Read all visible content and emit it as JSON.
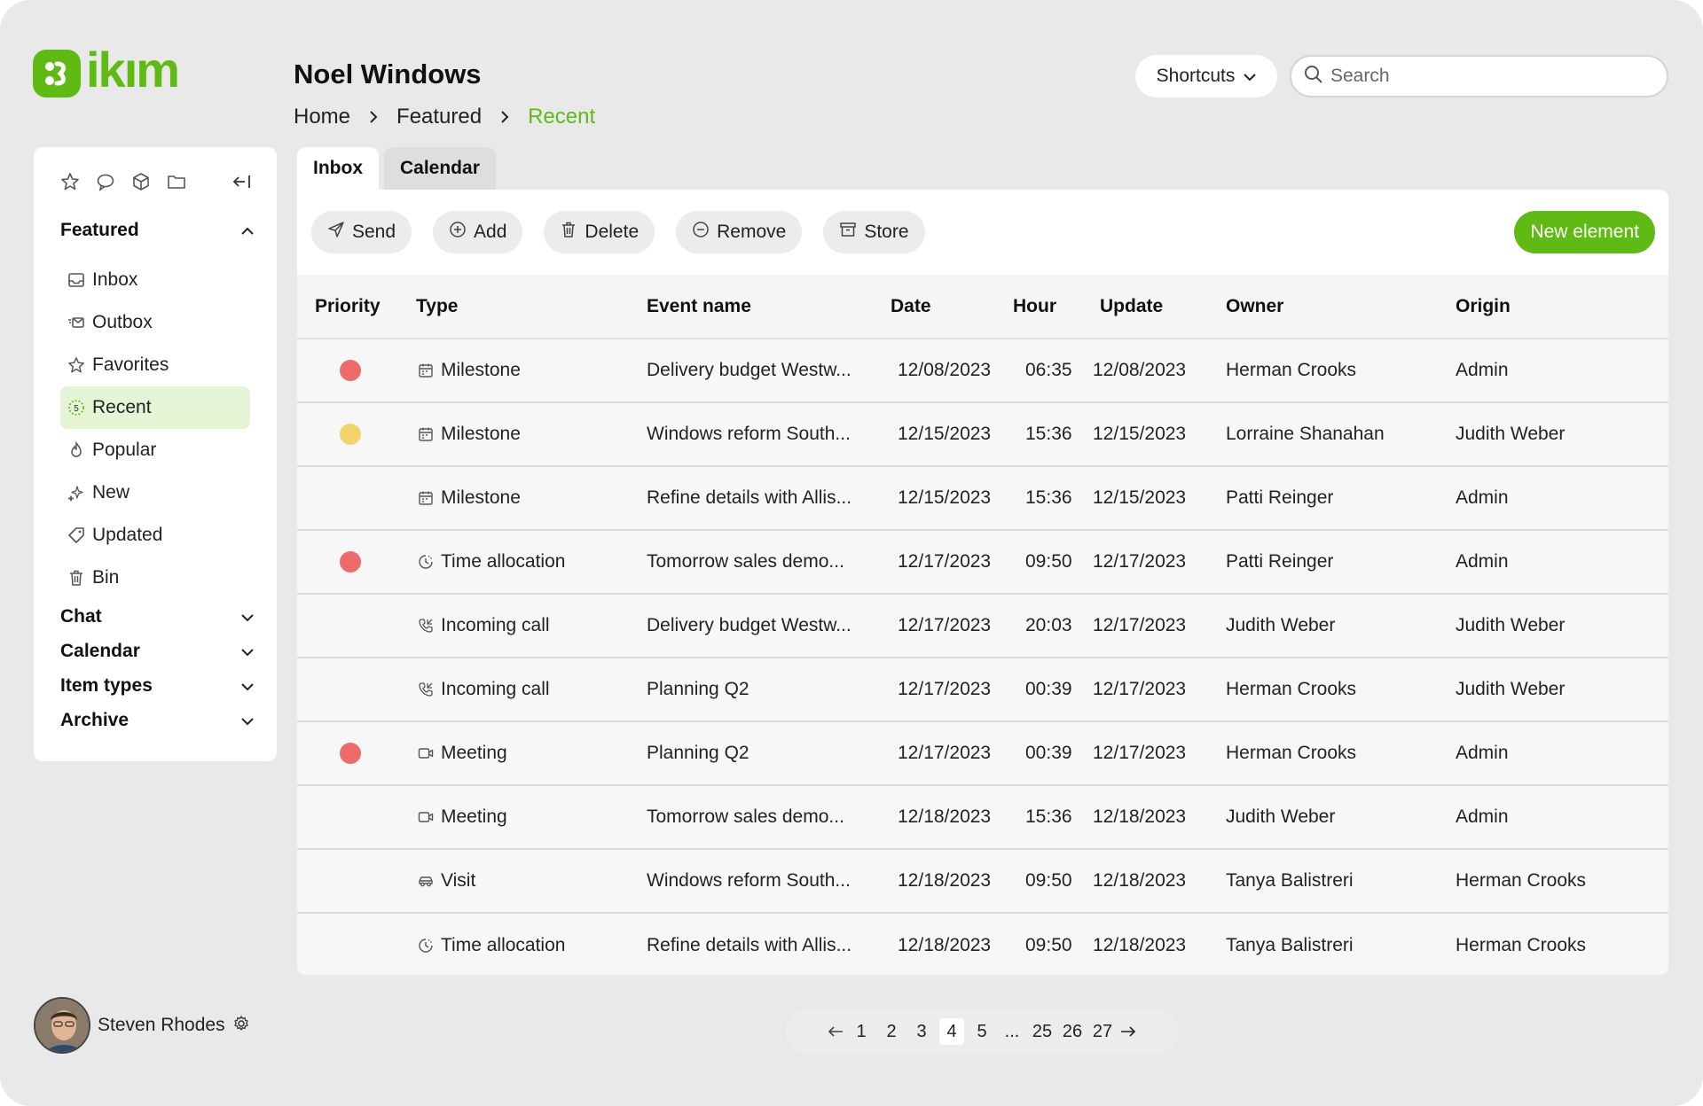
{
  "app": {
    "logo_text": "ikım"
  },
  "header": {
    "title": "Noel Windows",
    "breadcrumb": [
      "Home",
      "Featured",
      "Recent"
    ],
    "shortcuts_label": "Shortcuts",
    "search_placeholder": "Search"
  },
  "sidebar": {
    "sections": {
      "featured": "Featured",
      "chat": "Chat",
      "calendar": "Calendar",
      "item_types": "Item types",
      "archive": "Archive"
    },
    "items": [
      {
        "label": "Inbox",
        "icon": "inbox-icon"
      },
      {
        "label": "Outbox",
        "icon": "outbox-icon"
      },
      {
        "label": "Favorites",
        "icon": "star-icon"
      },
      {
        "label": "Recent",
        "icon": "recent-icon",
        "active": true
      },
      {
        "label": "Popular",
        "icon": "flame-icon"
      },
      {
        "label": "New",
        "icon": "sparkle-icon"
      },
      {
        "label": "Updated",
        "icon": "tag-icon"
      },
      {
        "label": "Bin",
        "icon": "trash-icon"
      }
    ]
  },
  "user": {
    "name": "Steven Rhodes"
  },
  "tabs": [
    "Inbox",
    "Calendar"
  ],
  "toolbar": {
    "send": "Send",
    "add": "Add",
    "delete": "Delete",
    "remove": "Remove",
    "store": "Store",
    "new_element": "New element"
  },
  "colors": {
    "accent": "#5fbb13",
    "priority_red": "#ef6b6b",
    "priority_yellow": "#f3d36b"
  },
  "table": {
    "columns": [
      "Priority",
      "Type",
      "Event name",
      "Date",
      "Hour",
      "Update",
      "Owner",
      "Origin"
    ],
    "rows": [
      {
        "priority": "red",
        "type": "Milestone",
        "type_icon": "calendar-icon",
        "event": "Delivery budget Westw...",
        "date": "12/08/2023",
        "hour": "06:35",
        "update": "12/08/2023",
        "owner": "Herman Crooks",
        "origin": "Admin"
      },
      {
        "priority": "yellow",
        "type": "Milestone",
        "type_icon": "calendar-icon",
        "event": "Windows reform South...",
        "date": "12/15/2023",
        "hour": "15:36",
        "update": "12/15/2023",
        "owner": "Lorraine Shanahan",
        "origin": "Judith Weber"
      },
      {
        "priority": "",
        "type": "Milestone",
        "type_icon": "calendar-icon",
        "event": "Refine details with Allis...",
        "date": "12/15/2023",
        "hour": "15:36",
        "update": "12/15/2023",
        "owner": "Patti Reinger",
        "origin": "Admin"
      },
      {
        "priority": "red",
        "type": "Time allocation",
        "type_icon": "clock-icon",
        "event": "Tomorrow sales demo...",
        "date": "12/17/2023",
        "hour": "09:50",
        "update": "12/17/2023",
        "owner": "Patti Reinger",
        "origin": "Admin"
      },
      {
        "priority": "",
        "type": "Incoming call",
        "type_icon": "phone-icon",
        "event": "Delivery budget Westw...",
        "date": "12/17/2023",
        "hour": "20:03",
        "update": "12/17/2023",
        "owner": "Judith Weber",
        "origin": "Judith Weber"
      },
      {
        "priority": "",
        "type": "Incoming call",
        "type_icon": "phone-icon",
        "event": "Planning Q2",
        "date": "12/17/2023",
        "hour": "00:39",
        "update": "12/17/2023",
        "owner": "Herman Crooks",
        "origin": "Judith Weber"
      },
      {
        "priority": "red",
        "type": "Meeting",
        "type_icon": "video-icon",
        "event": "Planning Q2",
        "date": "12/17/2023",
        "hour": "00:39",
        "update": "12/17/2023",
        "owner": "Herman Crooks",
        "origin": "Admin"
      },
      {
        "priority": "",
        "type": "Meeting",
        "type_icon": "video-icon",
        "event": "Tomorrow sales demo...",
        "date": "12/18/2023",
        "hour": "15:36",
        "update": "12/18/2023",
        "owner": "Judith Weber",
        "origin": "Admin"
      },
      {
        "priority": "",
        "type": "Visit",
        "type_icon": "car-icon",
        "event": "Windows reform South...",
        "date": "12/18/2023",
        "hour": "09:50",
        "update": "12/18/2023",
        "owner": "Tanya Balistreri",
        "origin": "Herman Crooks"
      },
      {
        "priority": "",
        "type": "Time allocation",
        "type_icon": "clock-icon",
        "event": "Refine details with Allis...",
        "date": "12/18/2023",
        "hour": "09:50",
        "update": "12/18/2023",
        "owner": "Tanya Balistreri",
        "origin": "Herman Crooks"
      }
    ]
  },
  "pagination": {
    "pages": [
      "1",
      "2",
      "3",
      "4",
      "5",
      "...",
      "25",
      "26",
      "27"
    ],
    "current": "4"
  }
}
